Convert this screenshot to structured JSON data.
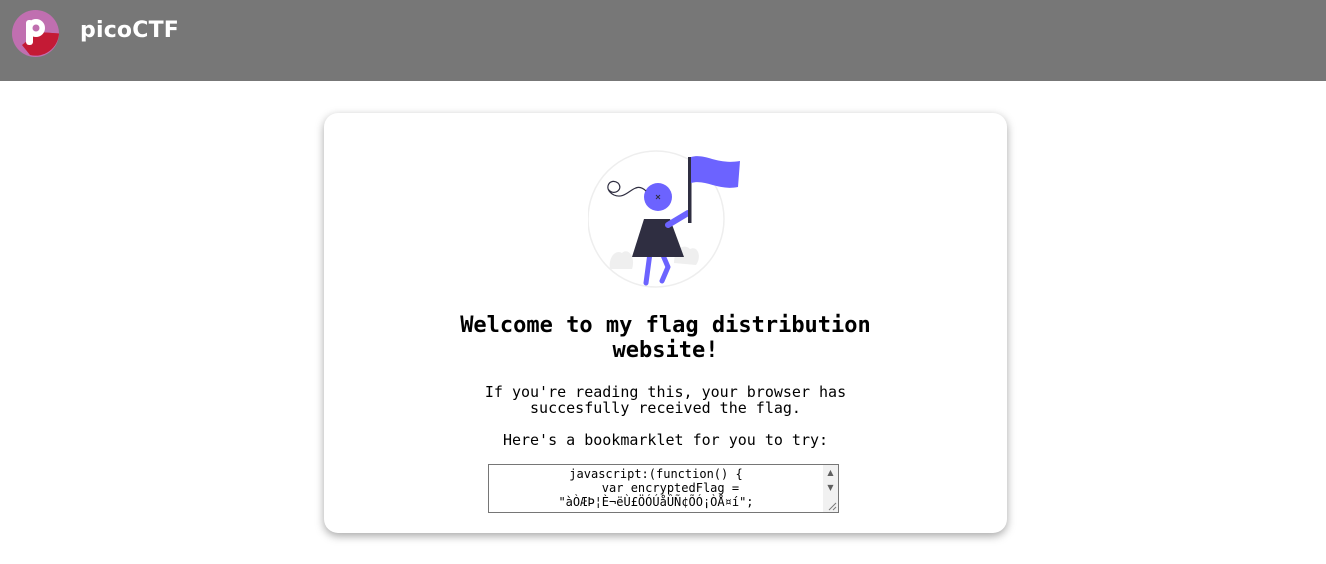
{
  "header": {
    "brand": "picoCTF",
    "bg_color": "#777777",
    "logo_icon": "picoctf-logo-icon",
    "logo_letter": "P"
  },
  "card": {
    "illustration": "woman-with-flag-illustration",
    "accent_color": "#6c63ff",
    "heading": "Welcome to my flag distribution website!",
    "paragraph1": "If you're reading this, your browser has succesfully received the flag.",
    "paragraph2": "Here's a bookmarklet for you to try:",
    "code_lines": [
      "javascript:(function() {",
      "    var encryptedFlag =",
      "\"àÒÆÞ¦È¬ëÙ£ÖÓÚåÛÑ¢ÕÓ¡ÒÅ¤í\";"
    ]
  }
}
